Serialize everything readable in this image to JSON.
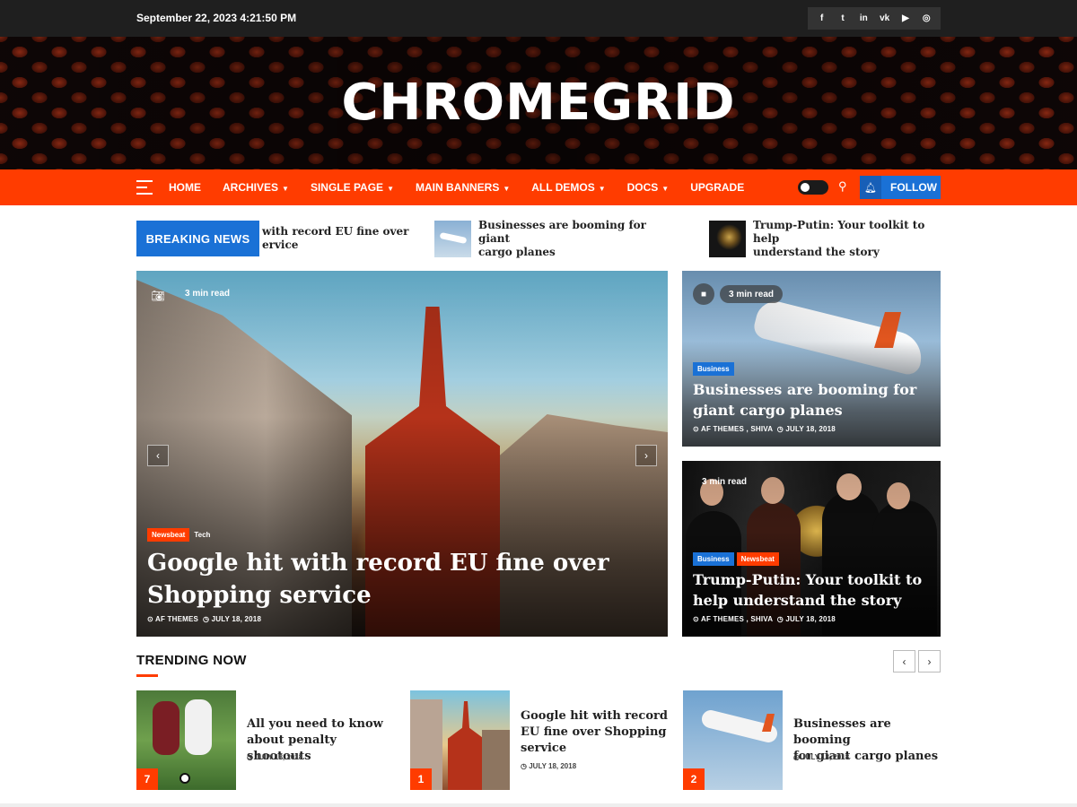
{
  "topbar": {
    "datetime": "September 22, 2023 4:21:50 PM",
    "socials": [
      {
        "icon": "facebook-icon",
        "glyph": "f"
      },
      {
        "icon": "twitter-icon",
        "glyph": "t"
      },
      {
        "icon": "linkedin-icon",
        "glyph": "in"
      },
      {
        "icon": "vk-icon",
        "glyph": "vk"
      },
      {
        "icon": "youtube-icon",
        "glyph": "▶"
      },
      {
        "icon": "instagram-icon",
        "glyph": "◎"
      }
    ]
  },
  "site": {
    "title": "CHROMEGRID"
  },
  "nav": {
    "items": [
      {
        "label": "HOME",
        "caret": ""
      },
      {
        "label": "ARCHIVES",
        "caret": "▼"
      },
      {
        "label": "SINGLE PAGE",
        "caret": "▼"
      },
      {
        "label": "MAIN BANNERS",
        "caret": "▼"
      },
      {
        "label": "ALL DEMOS",
        "caret": "▼"
      },
      {
        "label": "DOCS",
        "caret": "▼"
      },
      {
        "label": "UPGRADE",
        "caret": ""
      }
    ],
    "follow_label": "FOLLOW",
    "accent": "#ff3c00",
    "blue": "#1a71d6"
  },
  "breaking": {
    "label": "BREAKING NEWS",
    "items": [
      {
        "line1": "with record EU fine over",
        "line2": "ervice"
      },
      {
        "line1": "Businesses are booming for giant",
        "line2": "cargo planes"
      },
      {
        "line1": "Trump-Putin: Your toolkit to help",
        "line2": "understand the story"
      }
    ]
  },
  "main_feature": {
    "read_time": "3 min read",
    "tags": [
      "Newsbeat",
      "Tech"
    ],
    "title_line1": "Google hit with record EU fine over",
    "title_line2": "Shopping service",
    "author": "AF THEMES",
    "date": "JULY 18, 2018"
  },
  "side_cards": [
    {
      "read_time": "3 min read",
      "tags": [
        "Business"
      ],
      "title_line1": "Businesses are booming for",
      "title_line2": "giant cargo planes",
      "authors": "AF THEMES , SHIVA",
      "date": "JULY 18, 2018"
    },
    {
      "read_time": "3 min read",
      "tags": [
        "Business",
        "Newsbeat"
      ],
      "title_line1": "Trump-Putin: Your toolkit to",
      "title_line2": "help understand the story",
      "authors": "AF THEMES , SHIVA",
      "date": "JULY 18, 2018"
    }
  ],
  "trending": {
    "heading": "TRENDING NOW",
    "items": [
      {
        "num": "7",
        "line1": "All you need to know",
        "line2": "about penalty shootouts",
        "line3": "",
        "date": "JULY 18, 2018"
      },
      {
        "num": "1",
        "line1": "Google hit with record",
        "line2": "EU fine over Shopping",
        "line3": "service",
        "date": "JULY 18, 2018"
      },
      {
        "num": "2",
        "line1": "Businesses are booming",
        "line2": "for giant cargo planes",
        "line3": "",
        "date": "JULY 18, 2018"
      }
    ]
  }
}
